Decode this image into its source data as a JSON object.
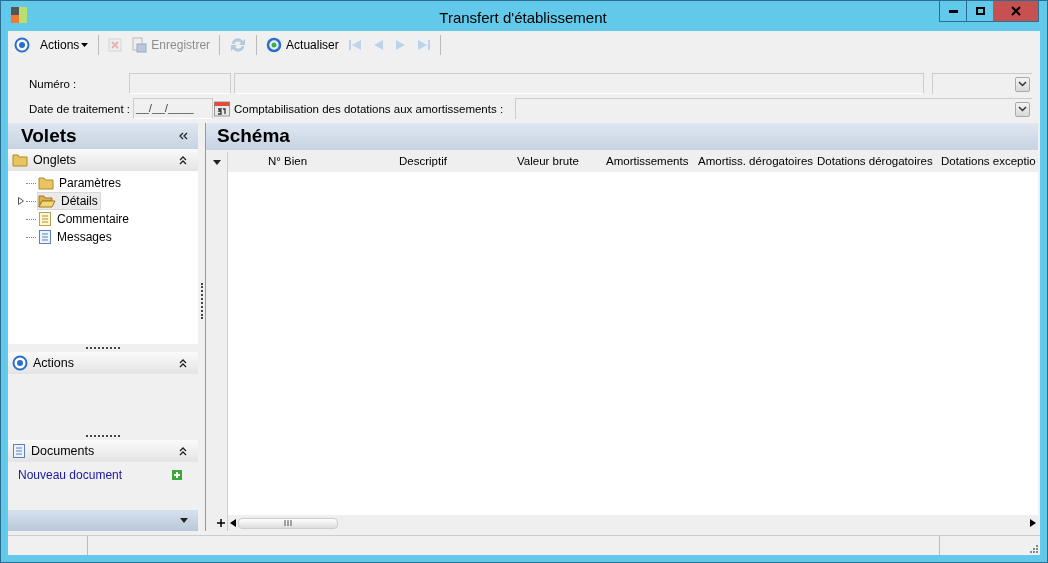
{
  "window": {
    "title": "Transfert d'établissement"
  },
  "toolbar": [
    {
      "kind": "target",
      "disabled": false
    },
    {
      "kind": "menu",
      "label": "Actions",
      "disabled": false
    },
    {
      "kind": "separator"
    },
    {
      "kind": "delete",
      "disabled": true
    },
    {
      "kind": "save",
      "label": "Enregistrer",
      "disabled": true
    },
    {
      "kind": "separator"
    },
    {
      "kind": "sync",
      "disabled": true
    },
    {
      "kind": "separator"
    },
    {
      "kind": "refresh",
      "label": "Actualiser",
      "disabled": false
    },
    {
      "kind": "first",
      "disabled": true
    },
    {
      "kind": "previous",
      "disabled": true
    },
    {
      "kind": "next",
      "disabled": true
    },
    {
      "kind": "last",
      "disabled": true
    },
    {
      "kind": "separator"
    }
  ],
  "form": {
    "numero_label": "Numéro :",
    "date_label": "Date de traitement :",
    "date_value": "__/__/____",
    "comptabilisation_label": "Comptabilisation des dotations aux amortissements :"
  },
  "sidebar": {
    "title": "Volets",
    "sections": [
      {
        "kind": "tree",
        "title": "Onglets",
        "items": [
          {
            "label": "Paramètres",
            "kind": "folder",
            "selected": false,
            "expandable": false
          },
          {
            "label": "Détails",
            "kind": "openfolder",
            "selected": true,
            "expandable": true
          },
          {
            "label": "Commentaire",
            "kind": "note",
            "selected": false,
            "expandable": false
          },
          {
            "label": "Messages",
            "kind": "document",
            "selected": false,
            "expandable": false
          }
        ]
      },
      {
        "kind": "actions",
        "title": "Actions"
      },
      {
        "kind": "links",
        "title": "Documents",
        "links": [
          {
            "label": "Nouveau document"
          }
        ]
      }
    ]
  },
  "grid": {
    "title": "Schéma",
    "columns": [
      "N° Bien",
      "Descriptif",
      "Valeur brute",
      "Amortissements",
      "Amortiss. dérogatoires",
      "Dotations dérogatoires",
      "Dotations exceptio"
    ]
  }
}
